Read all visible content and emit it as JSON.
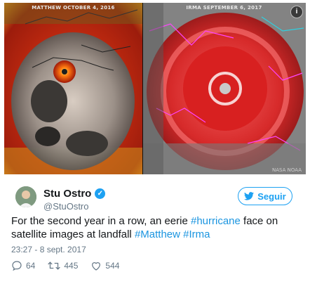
{
  "media": {
    "left_caption": "MATTHEW  OCTOBER 4, 2016",
    "right_caption": "IRMA  SEPTEMBER 6, 2017",
    "credit": "NASA NOAA",
    "info_badge": "i"
  },
  "author": {
    "name": "Stu Ostro",
    "handle": "@StuOstro",
    "verified_icon": "verified-badge-icon"
  },
  "follow_button": {
    "label": "Seguir",
    "icon": "bird-icon"
  },
  "tweet": {
    "text_before": "For the second year in a row, an eerie ",
    "tag1": "#hurricane",
    "text_middle": " face on satellite images at landfall ",
    "tag2": "#Matthew",
    "space": " ",
    "tag3": "#Irma",
    "timestamp": "23:27 - 8 sept. 2017"
  },
  "actions": {
    "reply_count": "64",
    "retweet_count": "445",
    "like_count": "544"
  },
  "colors": {
    "accent": "#1da1f2",
    "hashtag": "#1b95e0",
    "muted": "#657786"
  }
}
